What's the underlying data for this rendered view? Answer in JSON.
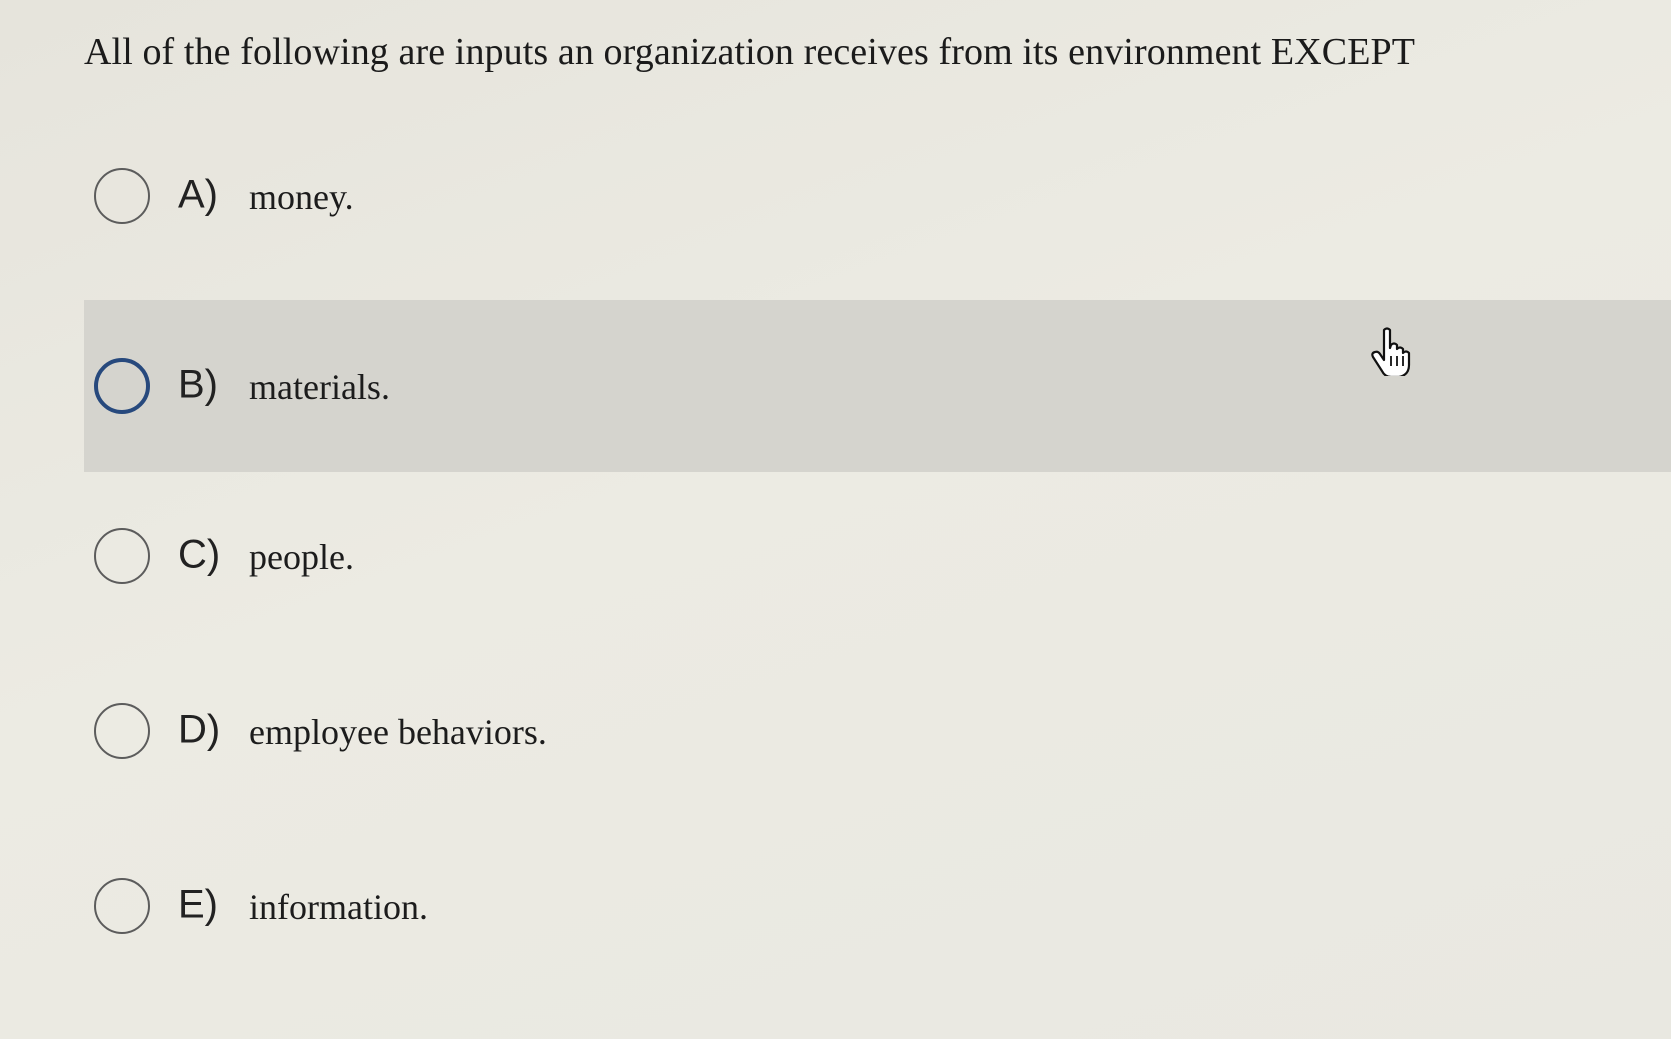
{
  "question": {
    "text": "All of the following are inputs an organization receives from its environment EXCEPT"
  },
  "options": [
    {
      "letter": "A)",
      "text": "money."
    },
    {
      "letter": "B)",
      "text": "materials."
    },
    {
      "letter": "C)",
      "text": "people."
    },
    {
      "letter": "D)",
      "text": "employee behaviors."
    },
    {
      "letter": "E)",
      "text": "information."
    }
  ],
  "hovered_option": "B)",
  "colors": {
    "hover_row": "#d5d4ce",
    "hover_radio": "#27497d",
    "radio_border": "#5c5c5c"
  },
  "icons": {
    "pointer": "hand-pointer-icon"
  }
}
